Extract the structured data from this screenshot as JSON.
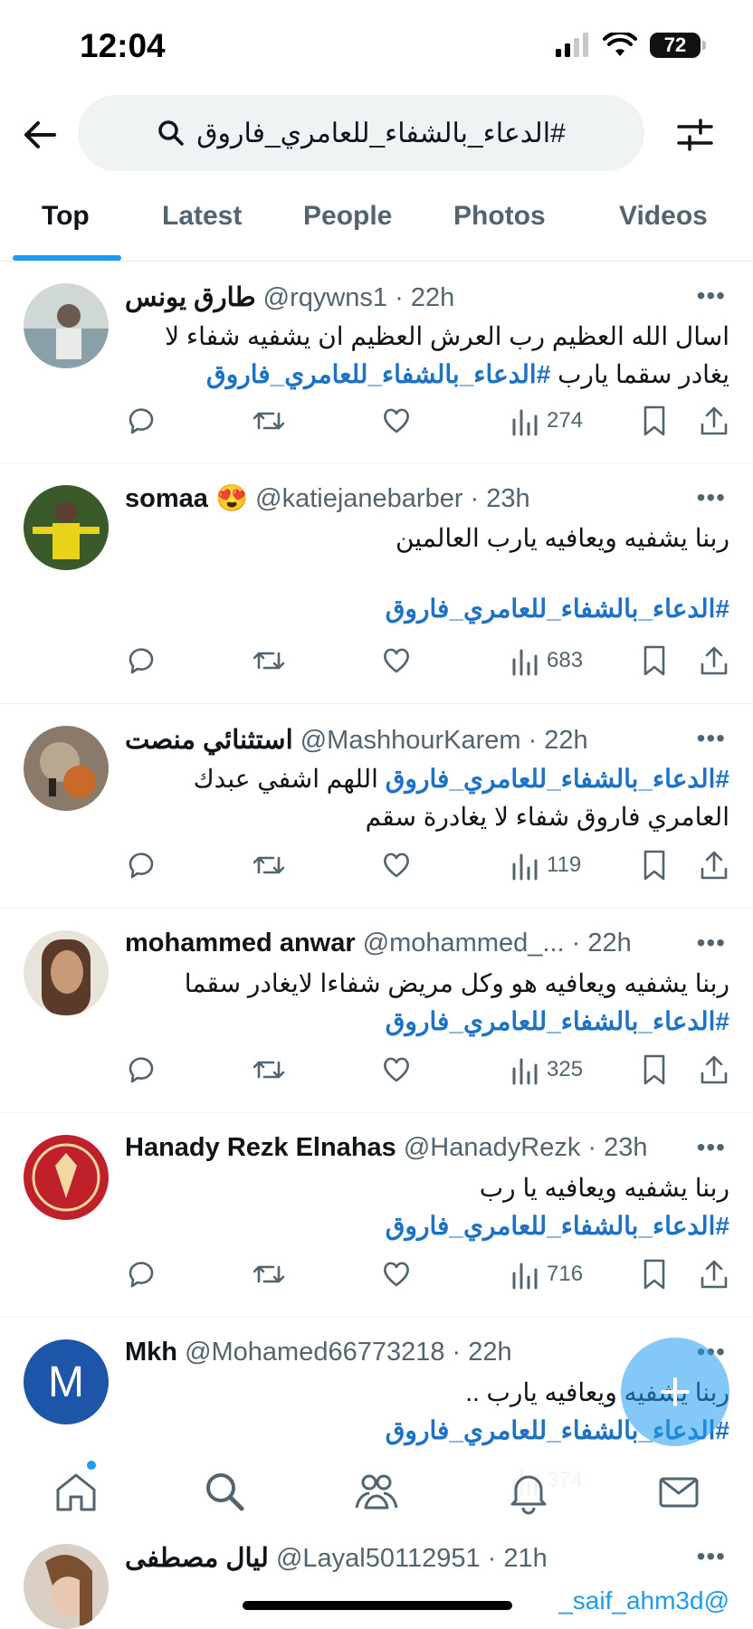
{
  "status": {
    "time": "12:04",
    "battery": "72"
  },
  "search": {
    "query": "#الدعاء_بالشفاء_للعامري_فاروق"
  },
  "tabs": [
    "Top",
    "Latest",
    "People",
    "Photos",
    "Videos"
  ],
  "tweets": [
    {
      "name": "طارق يونس",
      "handle": "@rqywns1 · 22h",
      "text": "اسال الله العظيم رب العرش العظيم ان يشفيه شفاء لا يغادر سقما يارب",
      "hashtag": "#الدعاء_بالشفاء_للعامري_فاروق",
      "views": "274"
    },
    {
      "name": "somaa",
      "emoji": "😍",
      "handle": "@katiejanebarber · 23h",
      "text": "ربنا يشفيه ويعافيه يارب العالمين",
      "hashtag": "#الدعاء_بالشفاء_للعامري_فاروق",
      "views": "683"
    },
    {
      "name": "استثنائي منصت",
      "handle": "@MashhourKarem · 22h",
      "text": "اللهم اشفي عبدك العامري فاروق شفاء لا يغادرة سقم",
      "hashtag": "#الدعاء_بالشفاء_للعامري_فاروق",
      "views": "119"
    },
    {
      "name": "mohammed anwar",
      "handle": "@mohammed_... · 22h",
      "text": "ربنا يشفيه ويعافيه هو وكل مريض شفاءا لايغادر سقما",
      "hashtag": "#الدعاء_بالشفاء_للعامري_فاروق",
      "views": "325"
    },
    {
      "name": "Hanady Rezk Elnahas",
      "handle": "@HanadyRezk · 23h",
      "text": "ربنا يشفيه ويعافيه يا رب",
      "hashtag": "#الدعاء_بالشفاء_للعامري_فاروق",
      "views": "716"
    },
    {
      "name": "Mkh",
      "handle": "@Mohamed66773218 · 22h",
      "text": "ربنا يشفيه ويعافيه يارب ..",
      "hashtag": "#الدعاء_بالشفاء_للعامري_فاروق",
      "views": "374",
      "avatar_letter": "M"
    },
    {
      "name": "ليال مصطفى",
      "handle": "@Layal50112951 · 21h",
      "mention": "@saif_ahm3d_"
    }
  ],
  "colors": {
    "accent": "#1d9bf0",
    "hashtag": "#1d72c6",
    "muted": "#536471"
  }
}
